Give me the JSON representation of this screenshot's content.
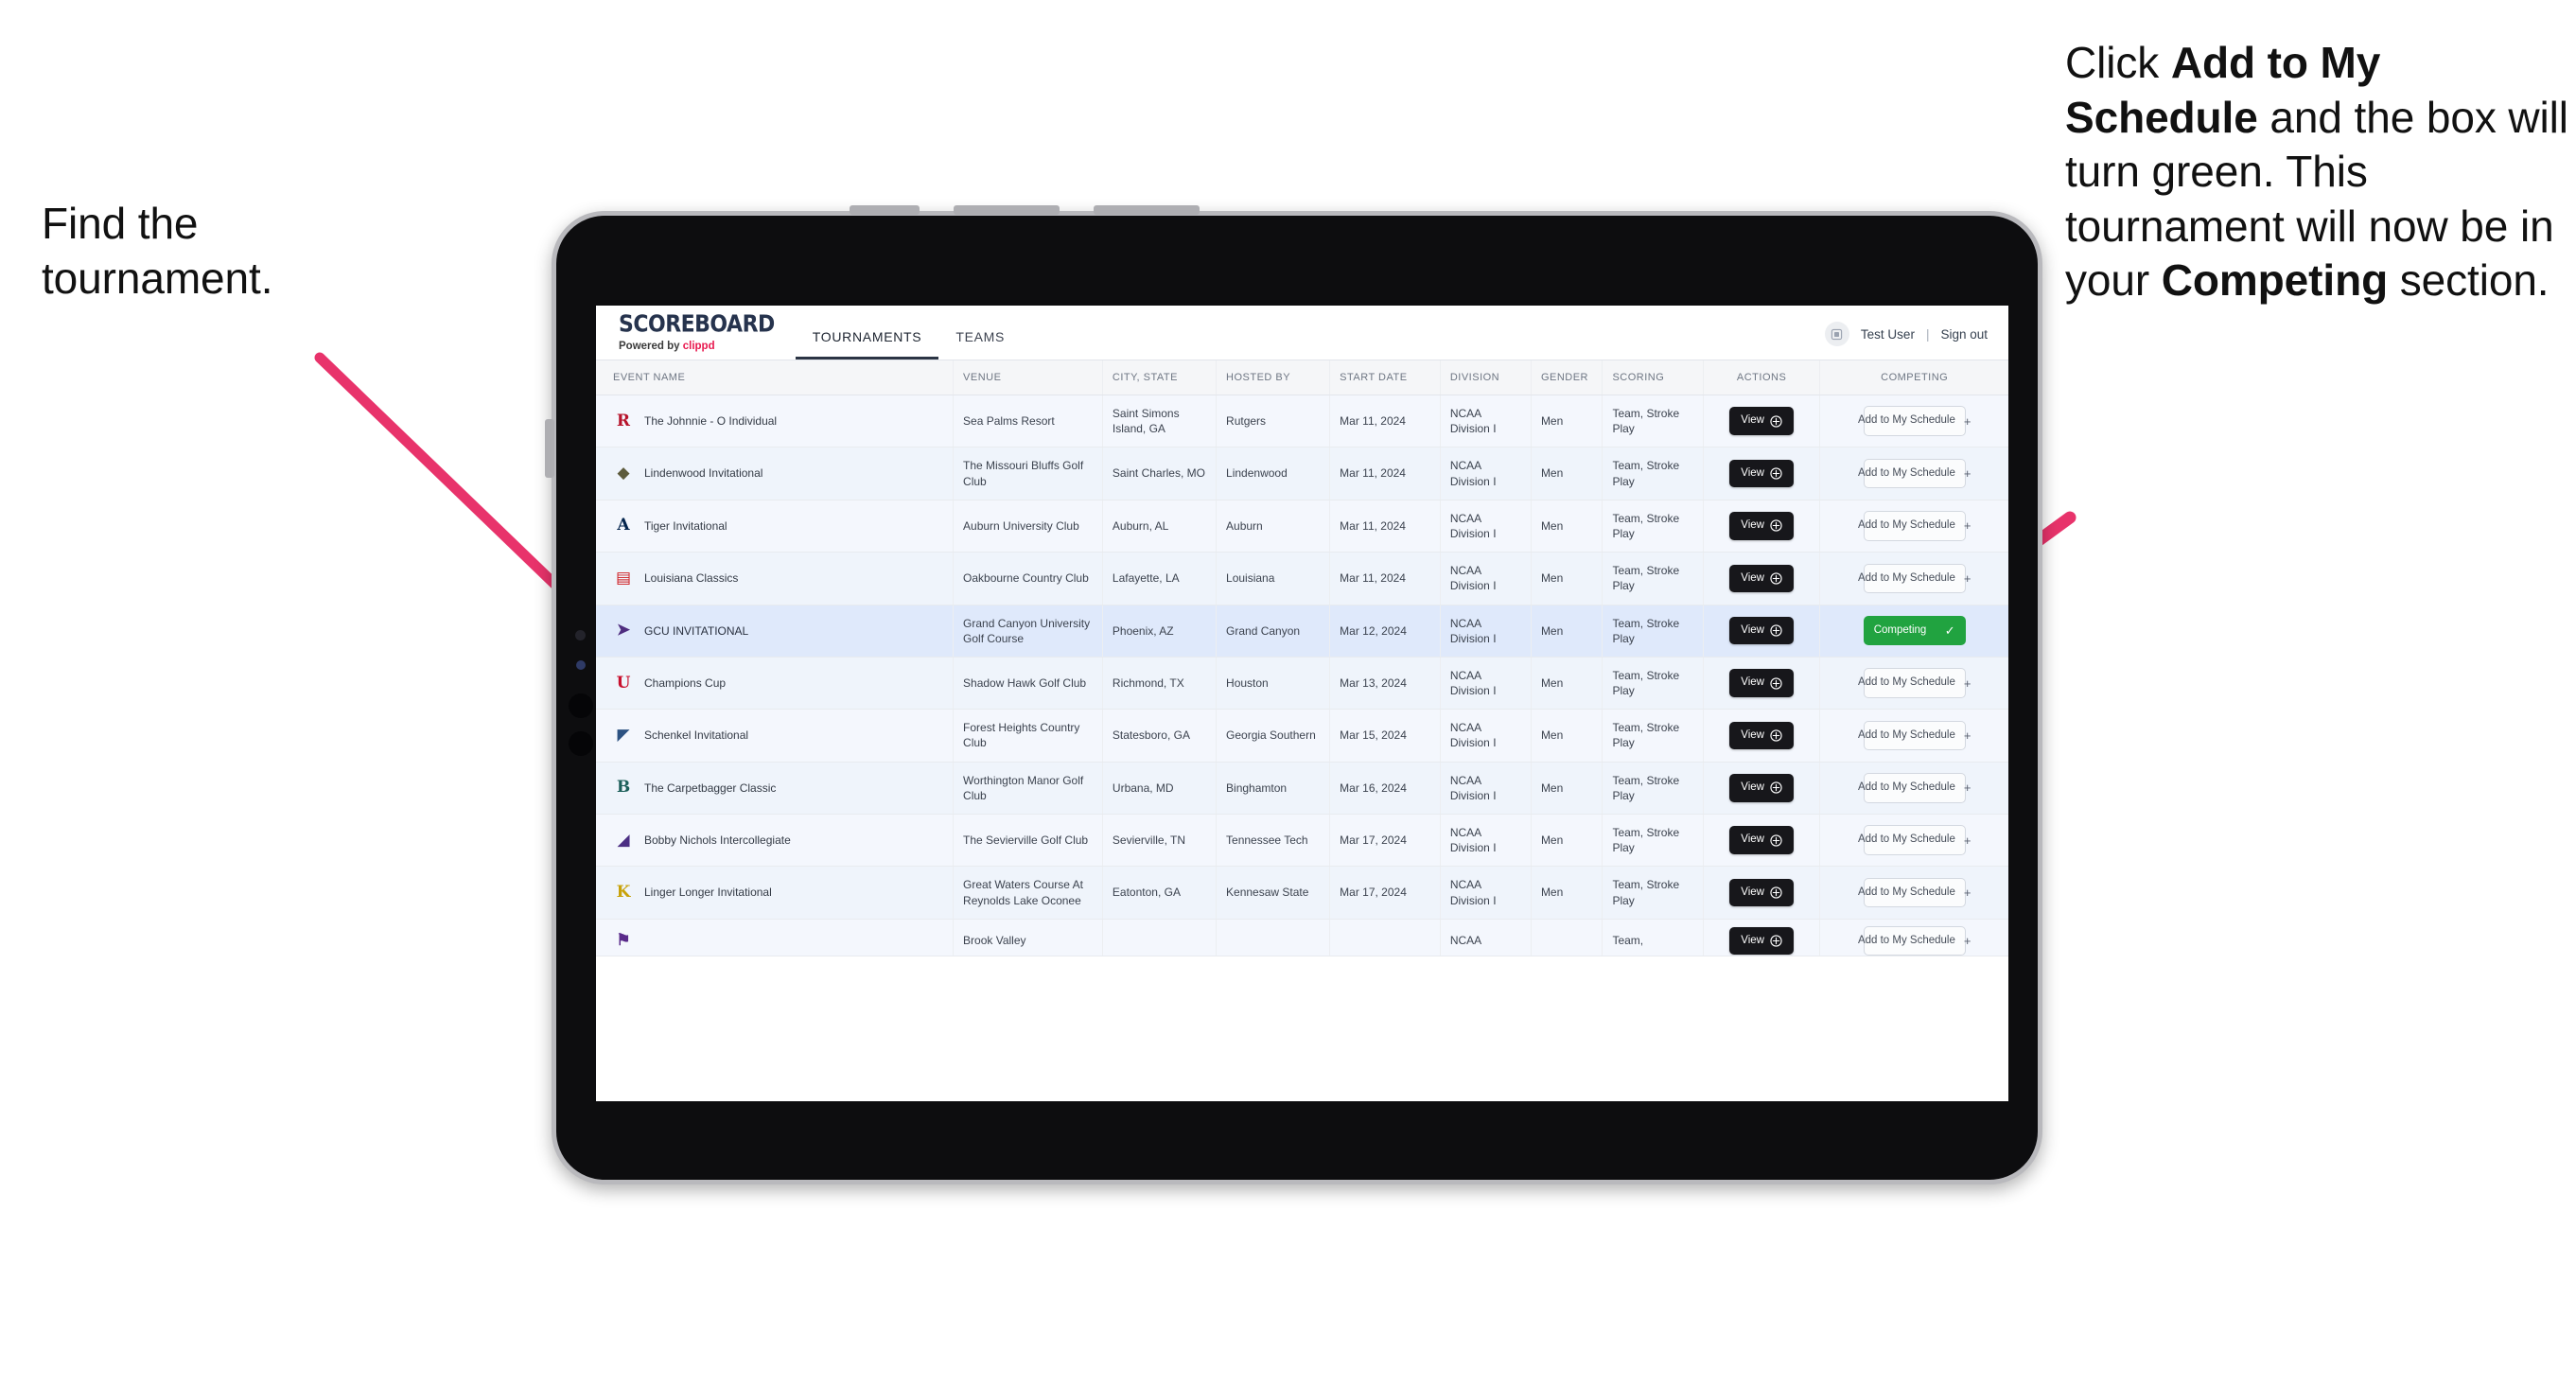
{
  "annotations": {
    "left": {
      "line1": "Find the",
      "line2": "tournament."
    },
    "right": {
      "seg1": "Click ",
      "bold1": "Add to My Schedule",
      "seg2": " and the box will turn green. This tournament will now be in your ",
      "bold2": "Competing",
      "seg3": " section."
    }
  },
  "app": {
    "brand": {
      "name": "SCOREBOARD",
      "powered_prefix": "Powered by ",
      "powered_brand": "clippd"
    },
    "nav": [
      {
        "label": "TOURNAMENTS",
        "active": true
      },
      {
        "label": "TEAMS",
        "active": false
      }
    ],
    "user": {
      "avatar_icon": "user-avatar-icon",
      "name": "Test User",
      "separator": "|",
      "sign_out": "Sign out"
    }
  },
  "table": {
    "columns": [
      "EVENT NAME",
      "VENUE",
      "CITY, STATE",
      "HOSTED BY",
      "START DATE",
      "DIVISION",
      "GENDER",
      "SCORING",
      "ACTIONS",
      "COMPETING"
    ],
    "view_label": "View",
    "add_label": "Add to My Schedule",
    "add_plus": "+",
    "competing_label": "Competing",
    "competing_check": "✓",
    "rows": [
      {
        "logo": "rutgers-logo-icon",
        "logo_text": "R",
        "logo_color": "#b6132b",
        "event": "The Johnnie - O Individual",
        "venue": "Sea Palms Resort",
        "city": "Saint Simons Island, GA",
        "host": "Rutgers",
        "date": "Mar 11, 2024",
        "division": "NCAA Division I",
        "gender": "Men",
        "scoring": "Team, Stroke Play",
        "competing": false
      },
      {
        "logo": "lindenwood-logo-icon",
        "logo_text": "◆",
        "logo_color": "#5d5b3c",
        "event": "Lindenwood Invitational",
        "venue": "The Missouri Bluffs Golf Club",
        "city": "Saint Charles, MO",
        "host": "Lindenwood",
        "date": "Mar 11, 2024",
        "division": "NCAA Division I",
        "gender": "Men",
        "scoring": "Team, Stroke Play",
        "competing": false
      },
      {
        "logo": "auburn-logo-icon",
        "logo_text": "A",
        "logo_color": "#03244d",
        "event": "Tiger Invitational",
        "venue": "Auburn University Club",
        "city": "Auburn, AL",
        "host": "Auburn",
        "date": "Mar 11, 2024",
        "division": "NCAA Division I",
        "gender": "Men",
        "scoring": "Team, Stroke Play",
        "competing": false
      },
      {
        "logo": "louisiana-ragin-cajuns-logo-icon",
        "logo_text": "▤",
        "logo_color": "#ce181e",
        "event": "Louisiana Classics",
        "venue": "Oakbourne Country Club",
        "city": "Lafayette, LA",
        "host": "Louisiana",
        "date": "Mar 11, 2024",
        "division": "NCAA Division I",
        "gender": "Men",
        "scoring": "Team, Stroke Play",
        "competing": false
      },
      {
        "logo": "grand-canyon-lopes-logo-icon",
        "logo_text": "➤",
        "logo_color": "#4f2d7f",
        "event": "GCU INVITATIONAL",
        "venue": "Grand Canyon University Golf Course",
        "city": "Phoenix, AZ",
        "host": "Grand Canyon",
        "date": "Mar 12, 2024",
        "division": "NCAA Division I",
        "gender": "Men",
        "scoring": "Team, Stroke Play",
        "competing": true,
        "selected": true
      },
      {
        "logo": "houston-cougars-logo-icon",
        "logo_text": "U",
        "logo_color": "#c8102e",
        "event": "Champions Cup",
        "venue": "Shadow Hawk Golf Club",
        "city": "Richmond, TX",
        "host": "Houston",
        "date": "Mar 13, 2024",
        "division": "NCAA Division I",
        "gender": "Men",
        "scoring": "Team, Stroke Play",
        "competing": false
      },
      {
        "logo": "georgia-southern-eagles-logo-icon",
        "logo_text": "◤",
        "logo_color": "#2c5282",
        "event": "Schenkel Invitational",
        "venue": "Forest Heights Country Club",
        "city": "Statesboro, GA",
        "host": "Georgia Southern",
        "date": "Mar 15, 2024",
        "division": "NCAA Division I",
        "gender": "Men",
        "scoring": "Team, Stroke Play",
        "competing": false
      },
      {
        "logo": "binghamton-bearcats-logo-icon",
        "logo_text": "B",
        "logo_color": "#1c5f5a",
        "event": "The Carpetbagger Classic",
        "venue": "Worthington Manor Golf Club",
        "city": "Urbana, MD",
        "host": "Binghamton",
        "date": "Mar 16, 2024",
        "division": "NCAA Division I",
        "gender": "Men",
        "scoring": "Team, Stroke Play",
        "competing": false
      },
      {
        "logo": "tennessee-tech-golden-eagles-logo-icon",
        "logo_text": "◢",
        "logo_color": "#4b2e83",
        "event": "Bobby Nichols Intercollegiate",
        "venue": "The Sevierville Golf Club",
        "city": "Sevierville, TN",
        "host": "Tennessee Tech",
        "date": "Mar 17, 2024",
        "division": "NCAA Division I",
        "gender": "Men",
        "scoring": "Team, Stroke Play",
        "competing": false
      },
      {
        "logo": "kennesaw-state-owls-logo-icon",
        "logo_text": "K",
        "logo_color": "#c8a20a",
        "event": "Linger Longer Invitational",
        "venue": "Great Waters Course At Reynolds Lake Oconee",
        "city": "Eatonton, GA",
        "host": "Kennesaw State",
        "date": "Mar 17, 2024",
        "division": "NCAA Division I",
        "gender": "Men",
        "scoring": "Team, Stroke Play",
        "competing": false
      },
      {
        "logo": "east-carolina-pirates-logo-icon",
        "logo_text": "⚑",
        "logo_color": "#592a8a",
        "event": "",
        "venue": "Brook Valley",
        "city": "",
        "host": "",
        "date": "",
        "division": "NCAA",
        "gender": "",
        "scoring": "Team,",
        "competing": false,
        "cut": true
      }
    ]
  },
  "colors": {
    "accent_pink": "#e8336b",
    "competing_green": "#21a340",
    "dark_button": "#17171b",
    "selected_row": "#dfe9fb"
  }
}
